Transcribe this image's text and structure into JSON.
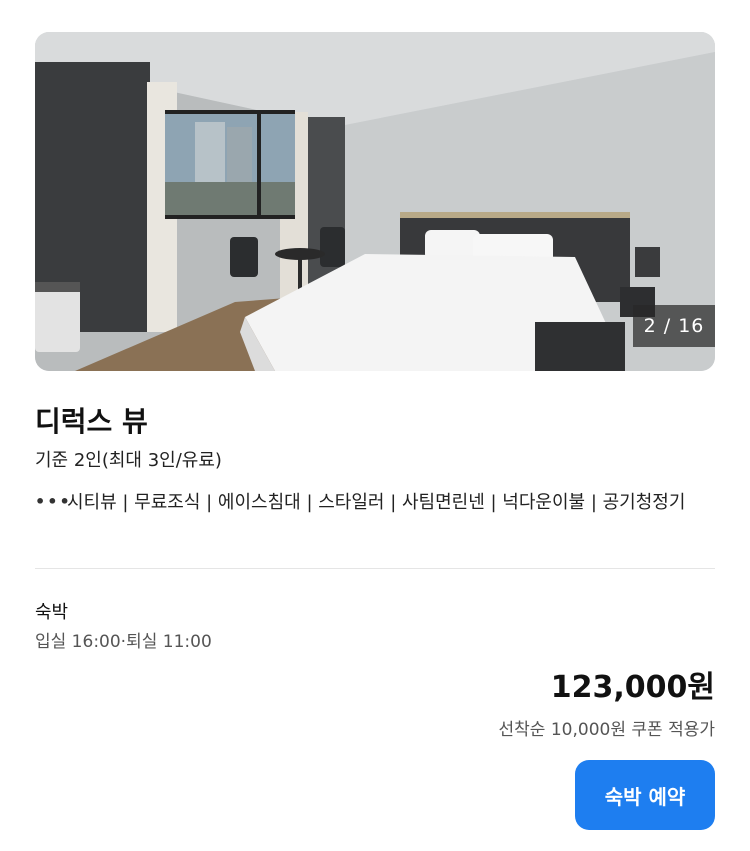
{
  "gallery": {
    "counter": "2 / 16"
  },
  "room": {
    "title": "디럭스 뷰",
    "capacity": "기준 2인(최대 3인/유료)",
    "amenities_icon": "more-dots-icon",
    "amenities": "시티뷰 | 무료조식 | 에이스침대 | 스타일러 | 사팀면린넨 | 넉다운이불 | 공기청정기"
  },
  "stay": {
    "label": "숙박",
    "times": "입실 16:00·퇴실 11:00",
    "price": "123,000원",
    "coupon_note": "선착순 10,000원 쿠폰 적용가",
    "reserve_label": "숙박 예약"
  },
  "colors": {
    "accent": "#1e7ef0"
  }
}
